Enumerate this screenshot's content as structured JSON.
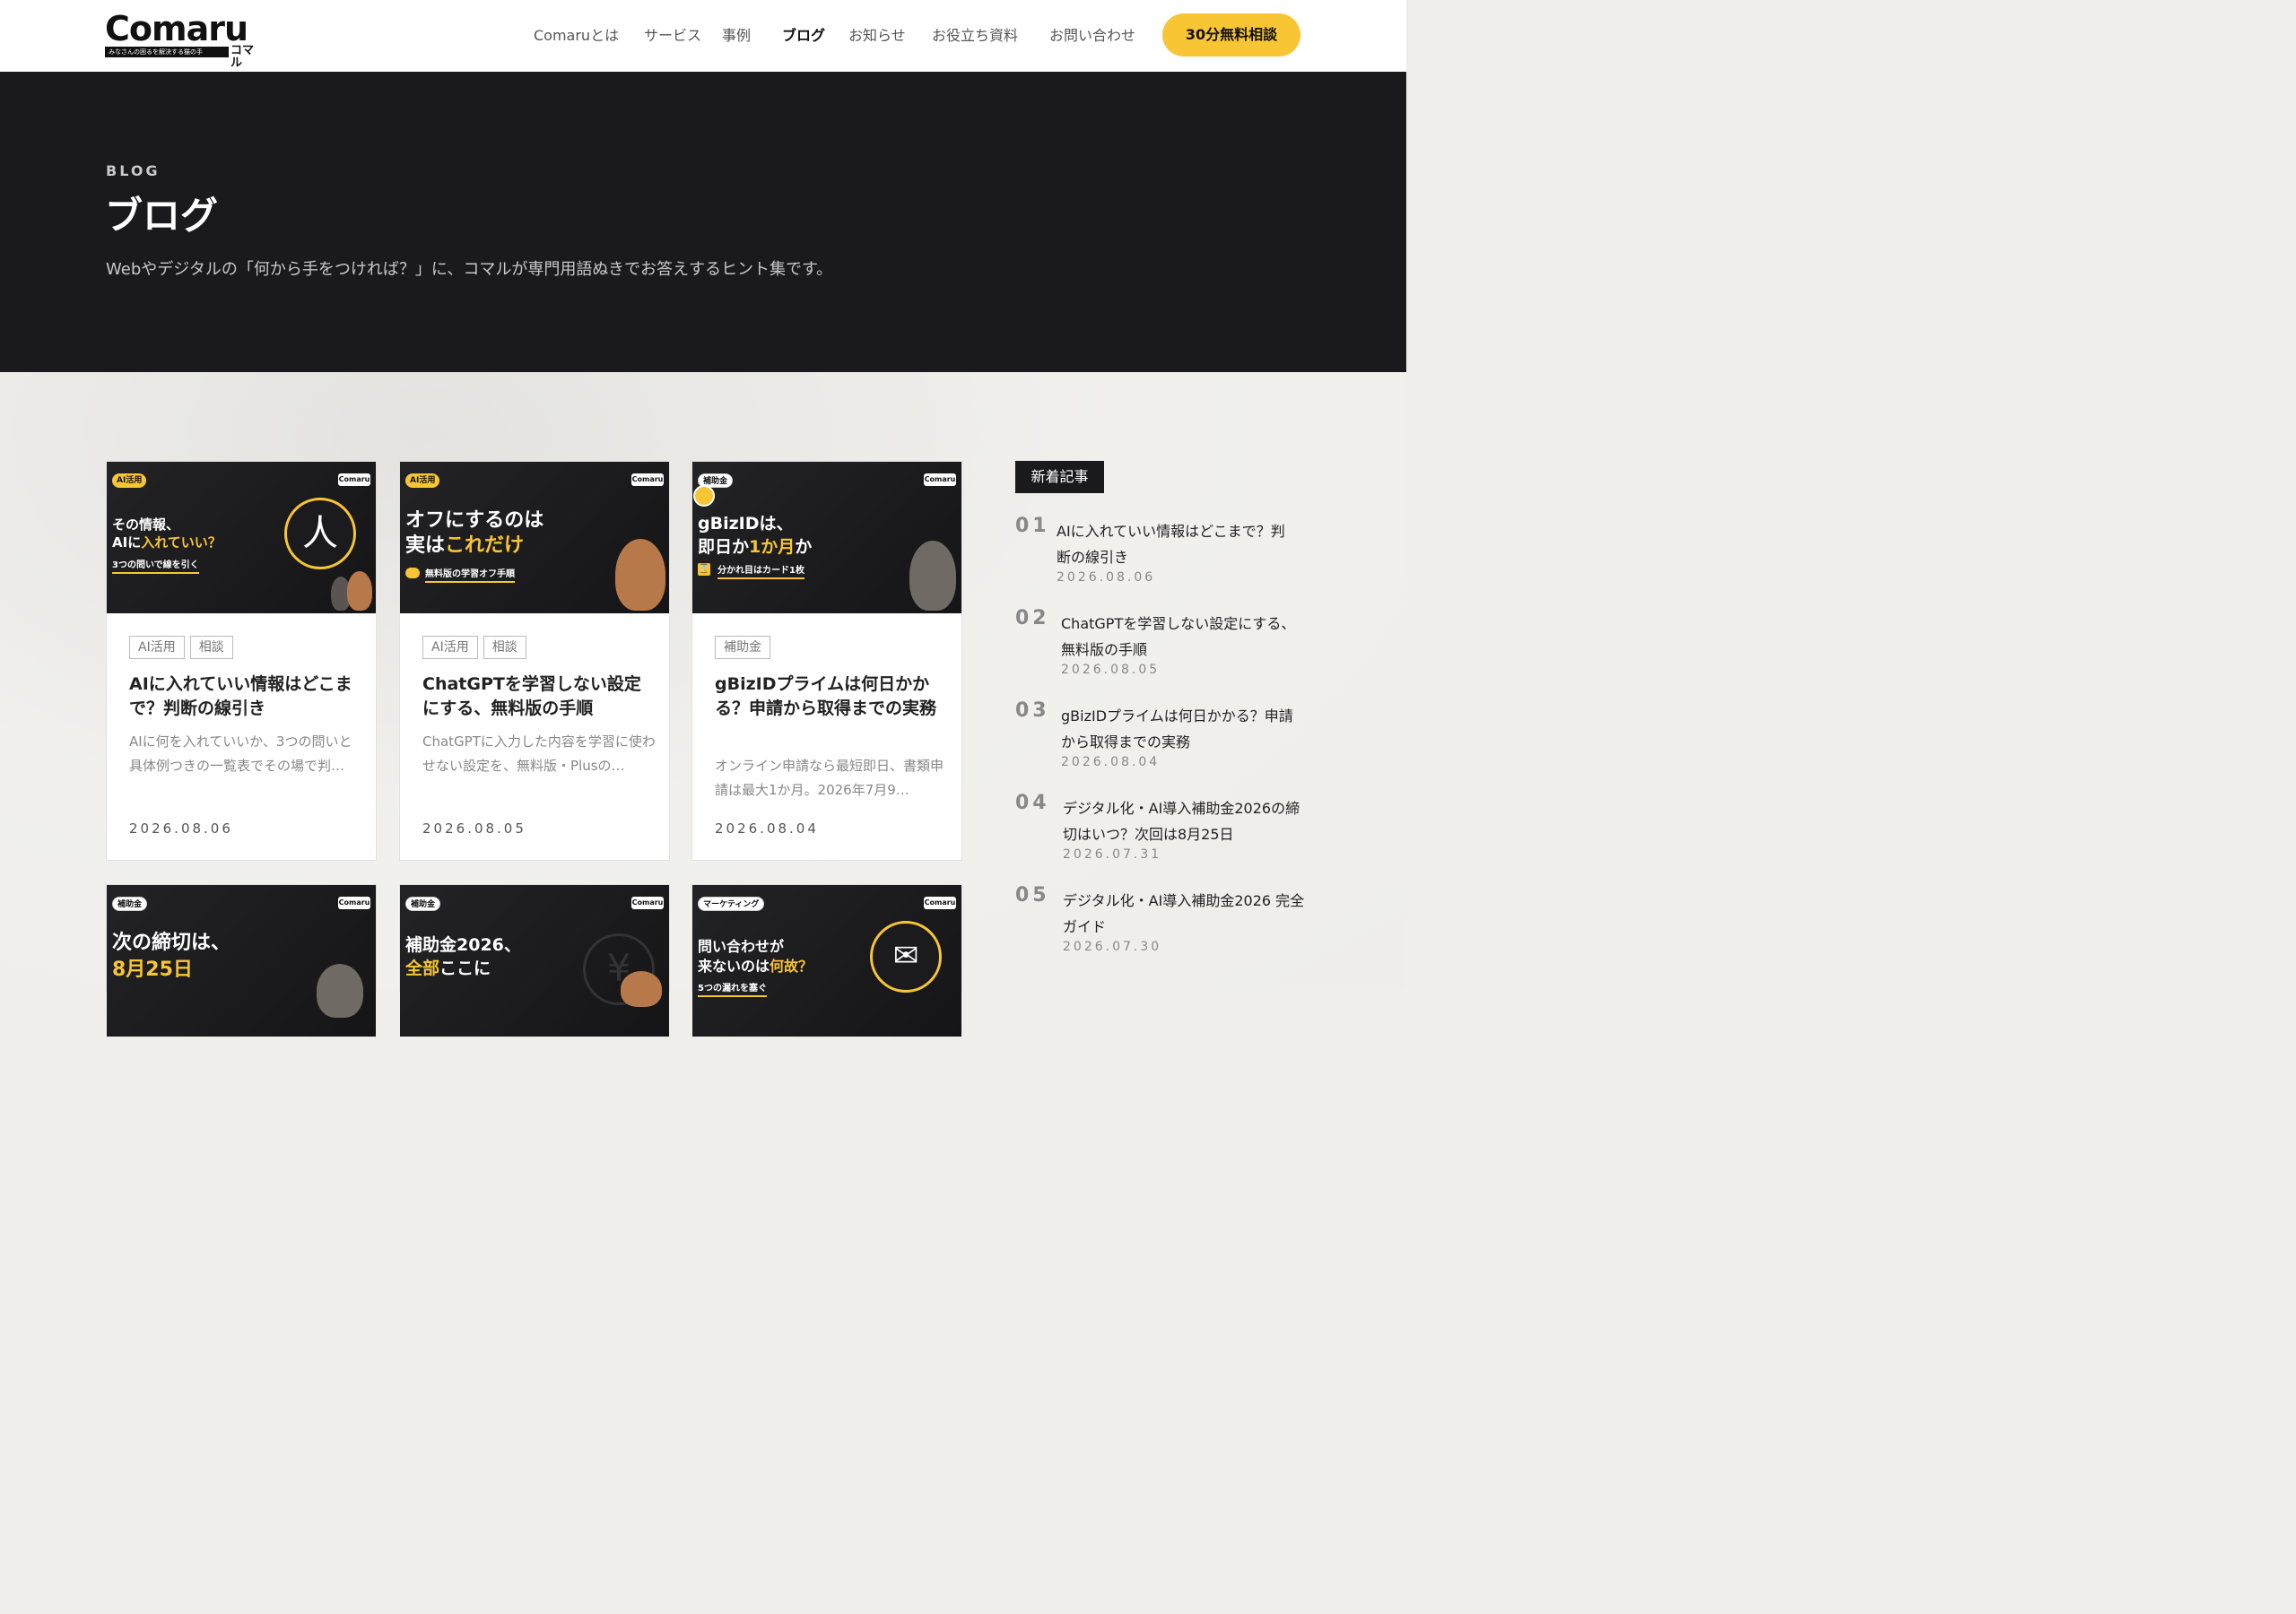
{
  "header": {
    "logo_text": "Comaru",
    "logo_tagline": "みなさんの困るを解決する猫の手",
    "logo_kana": "コマル",
    "nav": [
      {
        "label": "Comaruとは",
        "active": false
      },
      {
        "label": "サービス",
        "active": false
      },
      {
        "label": "事例",
        "active": false
      },
      {
        "label": "ブログ",
        "active": true
      },
      {
        "label": "お知らせ",
        "active": false
      },
      {
        "label": "お役立ち資料",
        "active": false
      },
      {
        "label": "お問い合わせ",
        "active": false
      }
    ],
    "cta_label": "30分無料相談"
  },
  "hero": {
    "eyebrow": "BLOG",
    "title": "ブログ",
    "description": "Webやデジタルの「何から手をつければ？」に、コマルが専門用語ぬきでお答えするヒント集です。"
  },
  "posts": [
    {
      "thumb_tag": "AI活用",
      "thumb_logo": "Comaru",
      "thumb_line1": "その情報、",
      "thumb_line2_a": "AIに",
      "thumb_line2_b": "入れていい？",
      "thumb_sub": "3つの問いで線を引く",
      "thumb_icon": "人",
      "tags": [
        "AI活用",
        "相談"
      ],
      "title": "AIに入れていい情報はどこまで？判断の線引き",
      "excerpt": "AIに何を入れていいか、3つの問いと具体例つきの一覧表でその場で判…",
      "date": "2026.08.06"
    },
    {
      "thumb_tag": "AI活用",
      "thumb_logo": "Comaru",
      "thumb_line1": "オフにするのは",
      "thumb_line2_a": "実は",
      "thumb_line2_b": "これだけ",
      "thumb_sub": "無料版の学習オフ手順",
      "tags": [
        "AI活用",
        "相談"
      ],
      "title": "ChatGPTを学習しない設定にする、無料版の手順",
      "excerpt": "ChatGPTに入力した内容を学習に使わせない設定を、無料版・Plusの…",
      "date": "2026.08.05"
    },
    {
      "thumb_tag": "補助金",
      "thumb_logo": "Comaru",
      "thumb_line1": "gBizIDは、",
      "thumb_line2_a": "即日か",
      "thumb_line2_b": "1か月",
      "thumb_line2_c": "か",
      "thumb_sub": "分かれ目はカード1枚",
      "tags": [
        "補助金"
      ],
      "title": "gBizIDプライムは何日かかる？申請から取得までの実務",
      "excerpt": "オンライン申請なら最短即日、書類申請は最大1か月。2026年7月9…",
      "date": "2026.08.04"
    },
    {
      "thumb_tag": "補助金",
      "thumb_logo": "Comaru",
      "thumb_line1": "次の締切は、",
      "thumb_line2_b": "8月25日"
    },
    {
      "thumb_tag": "補助金",
      "thumb_logo": "Comaru",
      "thumb_line1": "補助金2026、",
      "thumb_line2_b": "全部",
      "thumb_line2_c": "ここに",
      "thumb_icon": "¥"
    },
    {
      "thumb_tag": "マーケティング",
      "thumb_logo": "Comaru",
      "thumb_line1": "問い合わせが",
      "thumb_line2_a": "来ないのは",
      "thumb_line2_b": "何故？",
      "thumb_sub": "5つの漏れを塞ぐ",
      "thumb_icon": "✉"
    }
  ],
  "sidebar": {
    "label": "新着記事",
    "items": [
      {
        "num": "01",
        "title": "AIに入れていい情報はどこまで？判断の線引き",
        "date": "2026.08.06"
      },
      {
        "num": "02",
        "title": "ChatGPTを学習しない設定にする、無料版の手順",
        "date": "2026.08.05"
      },
      {
        "num": "03",
        "title": "gBizIDプライムは何日かかる？申請から取得までの実務",
        "date": "2026.08.04"
      },
      {
        "num": "04",
        "title": "デジタル化・AI導入補助金2026の締切はいつ？次回は8月25日",
        "date": "2026.07.31"
      },
      {
        "num": "05",
        "title": "デジタル化・AI導入補助金2026 完全ガイド",
        "date": "2026.07.30"
      }
    ]
  },
  "colors": {
    "accent": "#f8c535",
    "dark": "#1a1a1c"
  }
}
